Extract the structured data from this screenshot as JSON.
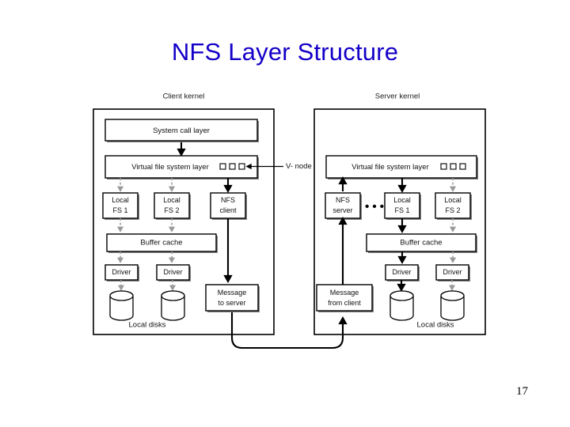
{
  "slide": {
    "title": "NFS Layer Structure",
    "title_color": "#1400c8",
    "page_number": "17"
  },
  "diagram": {
    "type": "block-diagram",
    "client": {
      "header": "Client kernel",
      "system_call_layer": "System call layer",
      "vfs_layer": "Virtual file system layer",
      "vnode_label": "V- node",
      "vnode_count": 3,
      "fs_row": [
        {
          "line1": "Local",
          "line2": "FS 1"
        },
        {
          "line1": "Local",
          "line2": "FS 2"
        },
        {
          "line1": "NFS",
          "line2": "client"
        }
      ],
      "buffer_cache": "Buffer cache",
      "drivers": [
        "Driver",
        "Driver"
      ],
      "disks_label": "Local disks",
      "message_box": {
        "line1": "Message",
        "line2": "to server"
      }
    },
    "server": {
      "header": "Server kernel",
      "vfs_layer": "Virtual file system layer",
      "vnode_count": 3,
      "ellipsis": "• • •",
      "fs_row": [
        {
          "line1": "NFS",
          "line2": "server"
        },
        {
          "line1": "Local",
          "line2": "FS 1"
        },
        {
          "line1": "Local",
          "line2": "FS 2"
        }
      ],
      "buffer_cache": "Buffer cache",
      "drivers": [
        "Driver",
        "Driver"
      ],
      "disks_label": "Local disks",
      "message_box": {
        "line1": "Message",
        "line2": "from client"
      }
    }
  }
}
